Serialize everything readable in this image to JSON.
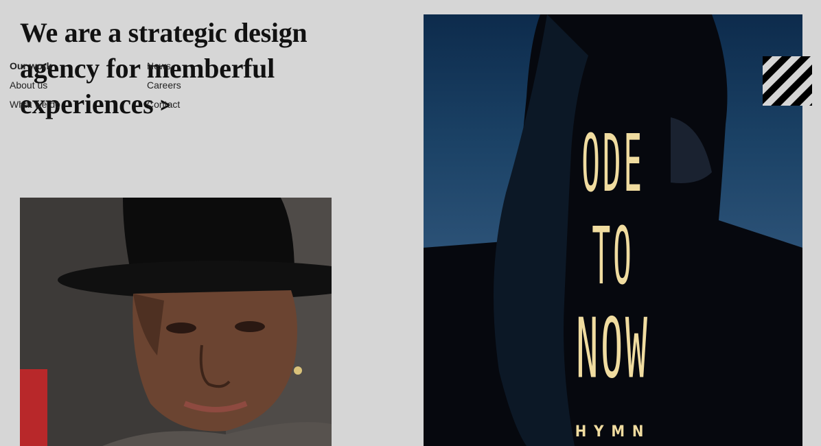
{
  "hero": {
    "heading": "We are a strategic design agency for memberful experiences",
    "arrow_icon": "chevron-right-icon"
  },
  "nav": {
    "column_1": [
      {
        "label": "Our work",
        "active": true
      },
      {
        "label": "About us",
        "active": false
      },
      {
        "label": "What we do",
        "active": false
      }
    ],
    "column_2": [
      {
        "label": "News",
        "active": false
      },
      {
        "label": "Careers",
        "active": false
      },
      {
        "label": "Contact",
        "active": false
      }
    ]
  },
  "poster": {
    "title_lines": [
      "ODE",
      "TO",
      "NOW"
    ],
    "brand": "HYMN",
    "text_color": "#f0dca0"
  },
  "menu_toggle": {
    "icon": "diagonal-stripes-menu-icon"
  },
  "colors": {
    "page_background": "#d6d6d6",
    "text": "#111111"
  }
}
